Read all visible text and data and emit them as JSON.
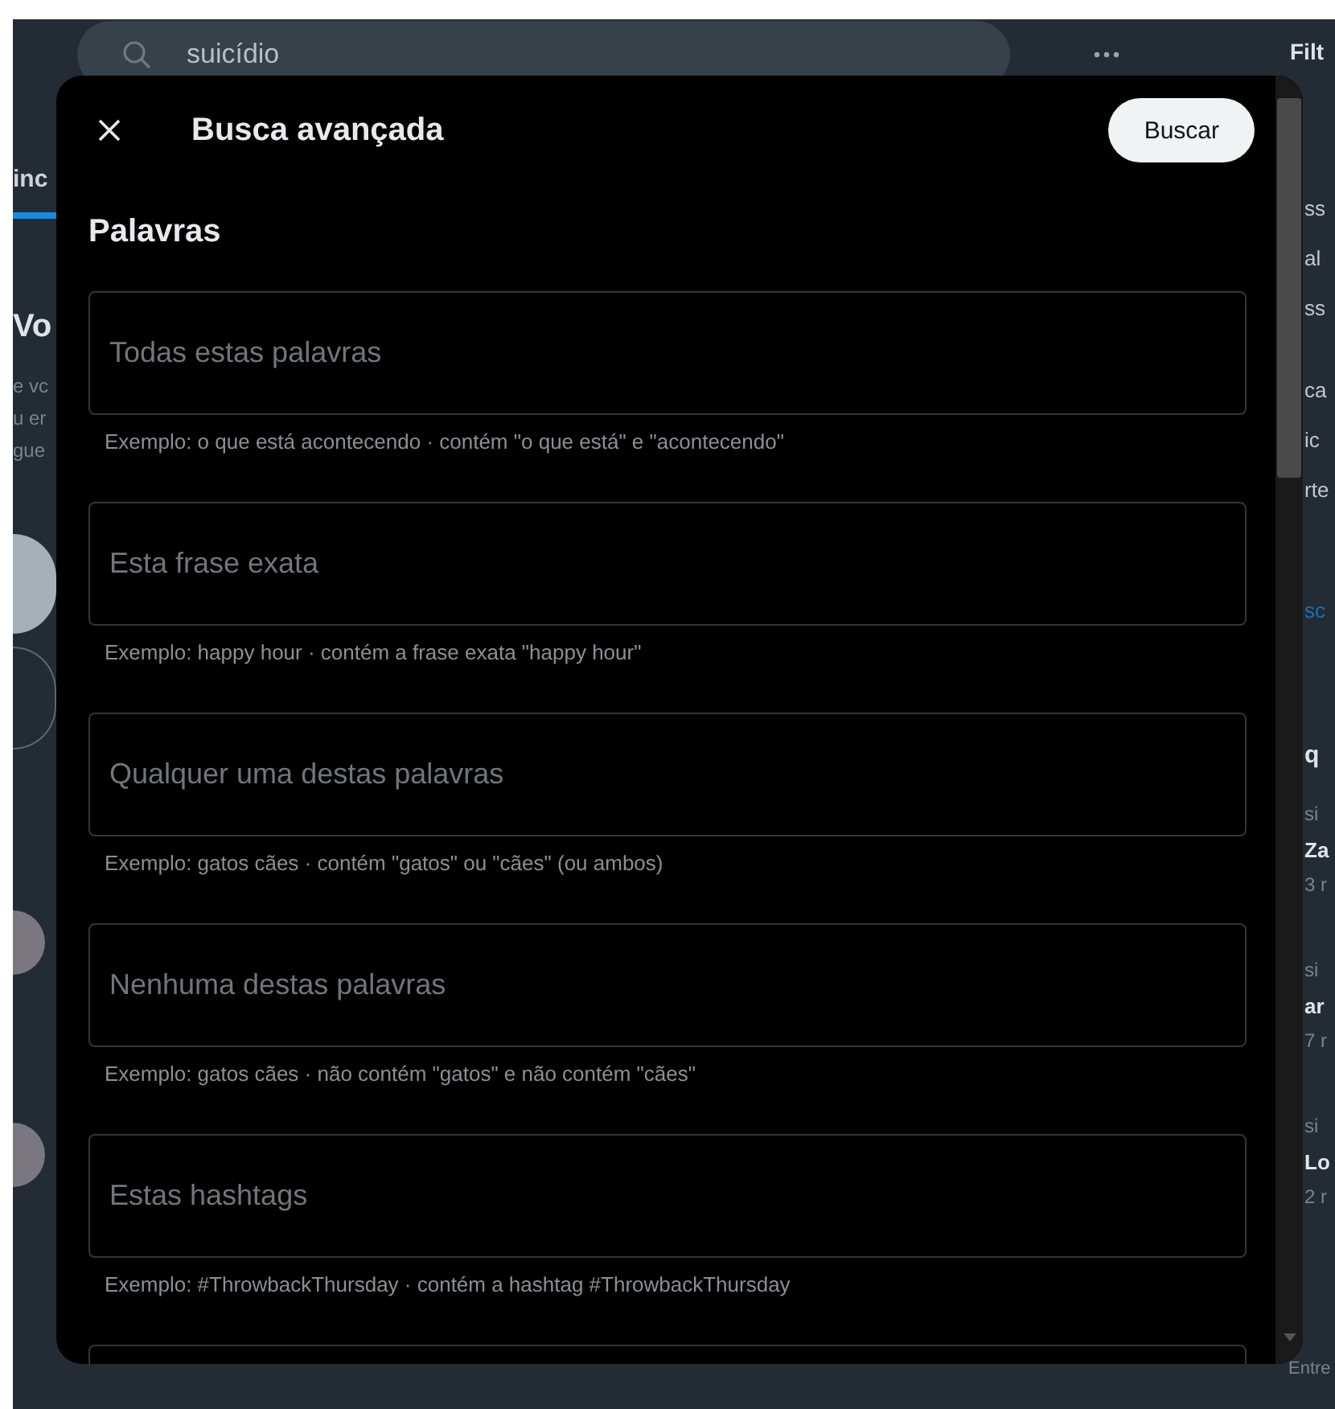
{
  "background": {
    "search": {
      "value": "suicídio"
    },
    "left_fragments": [
      {
        "text": "inc",
        "kind": "tab"
      },
      {
        "text": "Vo",
        "kind": "heading"
      },
      {
        "text": "e vc",
        "kind": "muted"
      },
      {
        "text": "u er",
        "kind": "muted"
      },
      {
        "text": "gue",
        "kind": "muted"
      }
    ],
    "right_fragments": [
      {
        "text": "Filt",
        "kind": "heading"
      },
      {
        "text": "ss",
        "kind": "plain"
      },
      {
        "text": "al",
        "kind": "plain"
      },
      {
        "text": "ss",
        "kind": "plain"
      },
      {
        "text": "ca",
        "kind": "plain"
      },
      {
        "text": "ic",
        "kind": "plain"
      },
      {
        "text": "rte",
        "kind": "plain"
      },
      {
        "text": "sc",
        "kind": "link"
      },
      {
        "text": "q",
        "kind": "heading"
      },
      {
        "text": "si",
        "kind": "muted"
      },
      {
        "text": "Za",
        "kind": "bold"
      },
      {
        "text": "3 r",
        "kind": "muted"
      },
      {
        "text": "si",
        "kind": "muted"
      },
      {
        "text": "ar",
        "kind": "bold"
      },
      {
        "text": "7 r",
        "kind": "muted"
      },
      {
        "text": "si",
        "kind": "muted"
      },
      {
        "text": "Lo",
        "kind": "bold"
      },
      {
        "text": "2 r",
        "kind": "muted"
      },
      {
        "text": "Entre",
        "kind": "muted"
      }
    ]
  },
  "dialog": {
    "title": "Busca avançada",
    "action": "Buscar",
    "section": "Palavras",
    "fields": [
      {
        "placeholder": "Todas estas palavras",
        "hint": "Exemplo: o que está acontecendo · contém \"o que está\" e \"acontecendo\""
      },
      {
        "placeholder": "Esta frase exata",
        "hint": "Exemplo: happy hour · contém a frase exata \"happy hour\""
      },
      {
        "placeholder": "Qualquer uma destas palavras",
        "hint": "Exemplo: gatos cães · contém \"gatos\" ou \"cães\" (ou ambos)"
      },
      {
        "placeholder": "Nenhuma destas palavras",
        "hint": "Exemplo: gatos cães · não contém \"gatos\" e não contém \"cães\""
      },
      {
        "placeholder": "Estas hashtags",
        "hint": "Exemplo: #ThrowbackThursday · contém a hashtag #ThrowbackThursday"
      }
    ]
  }
}
